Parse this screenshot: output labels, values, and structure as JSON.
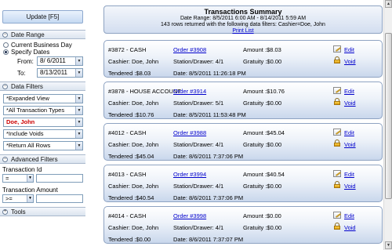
{
  "sidebar": {
    "update_label": "Update [F5]",
    "date_range": {
      "header": "Date Range",
      "opt_current": "Current Business Day",
      "opt_specify": "Specify Dates",
      "from_label": "From:",
      "from_value": "8/ 6/2011",
      "to_label": "To:",
      "to_value": "8/13/2011"
    },
    "data_filters": {
      "header": "Data Filters",
      "view": "*Expanded View",
      "types": "*All Transaction Types",
      "cashier": "Doe, John",
      "voids": "*Include Voids",
      "rows": "*Return All Rows"
    },
    "advanced": {
      "header": "Advanced Filters",
      "txn_id_label": "Transaction Id",
      "txn_id_op": "=",
      "txn_amt_label": "Transaction Amount",
      "txn_amt_op": ">="
    },
    "tools_header": "Tools",
    "colors": {
      "cashier_text": "#cc0000",
      "accent": "#0000cc"
    }
  },
  "summary": {
    "title": "Transactions Summary",
    "date_range": "Date Range: 8/5/2011 6:00 AM - 8/14/2011 5:59 AM",
    "rows_info": "143 rows returned with the following data filters: Cashier=Doe, John",
    "print": "Print List"
  },
  "transactions": [
    {
      "id": "#3872 - CASH",
      "order": "Order #3908",
      "amount": "Amount :$8.03",
      "cashier": "Cashier: Doe, John",
      "station": "Station/Drawer: 4/1",
      "gratuity": "Gratuity :$0.00",
      "tendered": "Tendered :$8.03",
      "date": "Date: 8/5/2011 11:26:18 PM",
      "edit": "Edit",
      "void": "Void"
    },
    {
      "id": "#3878 - HOUSE ACCOUNT",
      "order": "Order #3914",
      "amount": "Amount :$10.76",
      "cashier": "Cashier: Doe, John",
      "station": "Station/Drawer: 5/1",
      "gratuity": "Gratuity :$0.00",
      "tendered": "Tendered :$10.76",
      "date": "Date: 8/5/2011 11:53:48 PM",
      "edit": "Edit",
      "void": "Void"
    },
    {
      "id": "#4012 - CASH",
      "order": "Order #3988",
      "amount": "Amount :$45.04",
      "cashier": "Cashier: Doe, John",
      "station": "Station/Drawer: 4/1",
      "gratuity": "Gratuity :$0.00",
      "tendered": "Tendered :$45.04",
      "date": "Date: 8/6/2011 7:37:06 PM",
      "edit": "Edit",
      "void": "Void"
    },
    {
      "id": "#4013 - CASH",
      "order": "Order #3994",
      "amount": "Amount :$40.54",
      "cashier": "Cashier: Doe, John",
      "station": "Station/Drawer: 4/1",
      "gratuity": "Gratuity :$0.00",
      "tendered": "Tendered :$40.54",
      "date": "Date: 8/6/2011 7:37:06 PM",
      "edit": "Edit",
      "void": "Void"
    },
    {
      "id": "#4014 - CASH",
      "order": "Order #3998",
      "amount": "Amount :$0.00",
      "cashier": "Cashier: Doe, John",
      "station": "Station/Drawer: 4/1",
      "gratuity": "Gratuity :$0.00",
      "tendered": "Tendered :$0.00",
      "date": "Date: 8/6/2011 7:37:07 PM",
      "edit": "Edit",
      "void": "Void"
    }
  ]
}
